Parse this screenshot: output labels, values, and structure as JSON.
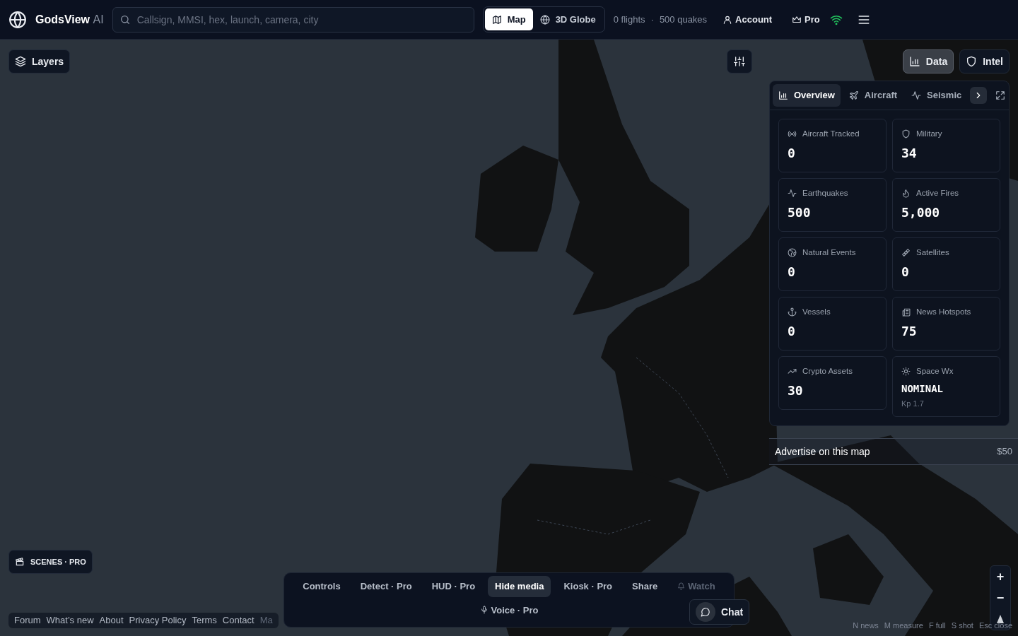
{
  "brand": {
    "name": "GodsView",
    "suffix": "AI"
  },
  "search": {
    "placeholder": "Callsign, MMSI, hex, launch, camera, city"
  },
  "view_toggle": [
    {
      "label": "Map",
      "selected": true
    },
    {
      "label": "3D Globe",
      "selected": false
    }
  ],
  "stats": {
    "flights": "0 flights",
    "separator": "·",
    "quakes": "500 quakes"
  },
  "account": "Account",
  "pro": "Pro",
  "layers_button": "Layers",
  "panel_toggle": [
    {
      "label": "Data",
      "selected": true
    },
    {
      "label": "Intel",
      "selected": false
    }
  ],
  "data_panel": {
    "tabs": [
      {
        "label": "Overview",
        "selected": true
      },
      {
        "label": "Aircraft",
        "selected": false
      },
      {
        "label": "Seismic",
        "selected": false
      }
    ],
    "cards": [
      {
        "label": "Aircraft Tracked",
        "value": "0"
      },
      {
        "label": "Military",
        "value": "34"
      },
      {
        "label": "Earthquakes",
        "value": "500"
      },
      {
        "label": "Active Fires",
        "value": "5,000"
      },
      {
        "label": "Natural Events",
        "value": "0"
      },
      {
        "label": "Satellites",
        "value": "0"
      },
      {
        "label": "Vessels",
        "value": "0"
      },
      {
        "label": "News Hotspots",
        "value": "75"
      },
      {
        "label": "Crypto Assets",
        "value": "30"
      },
      {
        "label": "Space Wx",
        "value": "NOMINAL",
        "note": "Kp 1.7"
      }
    ]
  },
  "ad": {
    "text": "Advertise on this map",
    "price": "$50"
  },
  "scenes_button": "SCENES · PRO",
  "bottom_bar": {
    "items": [
      {
        "label": "Controls",
        "selected": false,
        "disabled": false
      },
      {
        "label": "Detect · Pro",
        "selected": false,
        "disabled": false
      },
      {
        "label": "HUD · Pro",
        "selected": false,
        "disabled": false
      },
      {
        "label": "Hide media",
        "selected": true,
        "disabled": false
      },
      {
        "label": "Kiosk · Pro",
        "selected": false,
        "disabled": false
      },
      {
        "label": "Share",
        "selected": false,
        "disabled": false
      },
      {
        "label": "Watch",
        "selected": false,
        "disabled": true
      }
    ],
    "voice": "Voice · Pro"
  },
  "chat": "Chat",
  "footer_links": [
    "Forum",
    "What’s new",
    "About",
    "Privacy Policy",
    "Terms",
    "Contact",
    "Ma"
  ],
  "zoom_controls": [
    "+",
    "−"
  ],
  "shortcuts": [
    "N news",
    "M measure",
    "F full",
    "S shot",
    "Esc close"
  ]
}
